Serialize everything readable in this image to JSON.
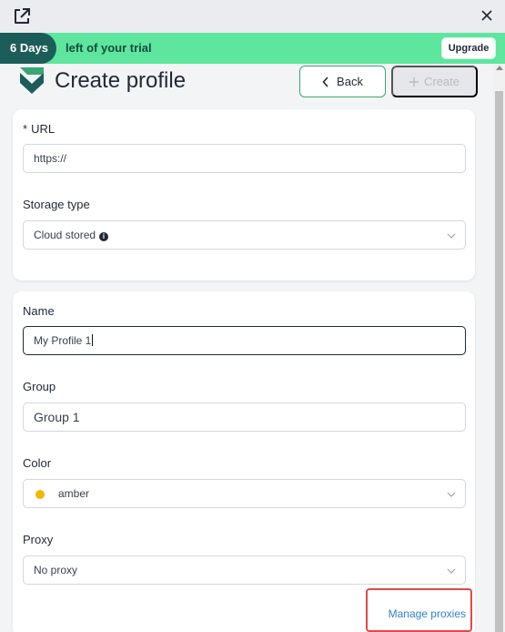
{
  "topbar": {
    "open_icon": "external-link-icon",
    "close_icon": "close-icon"
  },
  "trial": {
    "days": "6 Days",
    "message": "left of your trial",
    "upgrade_label": "Upgrade"
  },
  "header": {
    "title": "Create profile",
    "back_label": "Back",
    "create_label": "Create"
  },
  "section1": {
    "url_label": "URL",
    "url_required_mark": "*",
    "url_value": "https://",
    "storage_label": "Storage type",
    "storage_value": "Cloud stored",
    "storage_info_icon": "info-icon"
  },
  "section2": {
    "name_label": "Name",
    "name_value": "My Profile 1",
    "group_label": "Group",
    "group_value": "Group 1",
    "color_label": "Color",
    "color_value": "amber",
    "color_hex": "#f5b700",
    "proxy_label": "Proxy",
    "proxy_value": "No proxy",
    "manage_proxies_label": "Manage proxies"
  },
  "colors": {
    "accent": "#3aa673",
    "trial_bg": "#5ee59e",
    "days_bg": "#1c5d5a",
    "link": "#2f7fd1",
    "highlight": "#e04848"
  }
}
